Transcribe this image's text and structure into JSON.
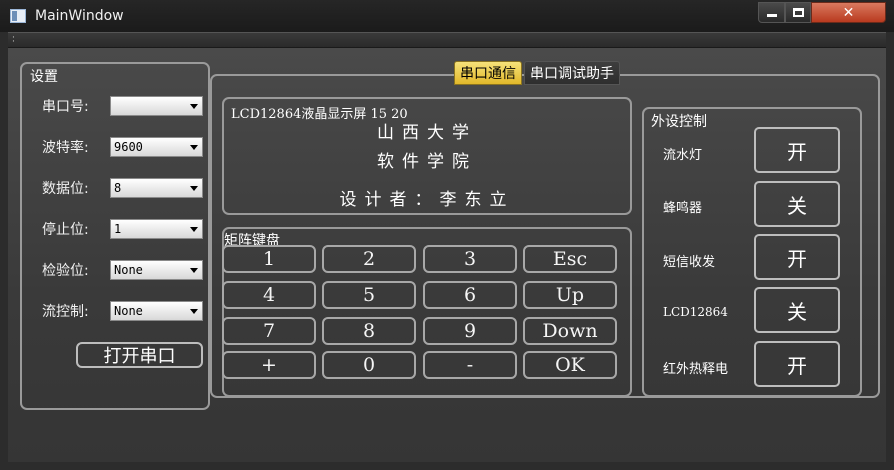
{
  "window": {
    "title": "MainWindow",
    "close_symbol": "✕"
  },
  "settings": {
    "title": "设置",
    "rows": [
      {
        "label": "串口号:",
        "value": ""
      },
      {
        "label": "波特率:",
        "value": "9600"
      },
      {
        "label": "数据位:",
        "value": "8"
      },
      {
        "label": "停止位:",
        "value": "1"
      },
      {
        "label": "检验位:",
        "value": "None"
      },
      {
        "label": "流控制:",
        "value": "None"
      }
    ],
    "open_port_label": "打开串口"
  },
  "tabs": [
    {
      "label": "串口通信",
      "active": true
    },
    {
      "label": "串口调试助手",
      "active": false
    }
  ],
  "lcd": {
    "title": "LCD12864液晶显示屏   15 20",
    "line1": "山西大学",
    "line2": "软件学院",
    "line3": "设计者：李东立"
  },
  "keypad": {
    "title": "矩阵键盘",
    "keys": [
      [
        "1",
        "2",
        "3",
        "Esc"
      ],
      [
        "4",
        "5",
        "6",
        "Up"
      ],
      [
        "7",
        "8",
        "9",
        "Down"
      ],
      [
        "+",
        "0",
        "-",
        "OK"
      ]
    ]
  },
  "peripherals": {
    "title": "外设控制",
    "items": [
      {
        "label": "流水灯",
        "state": "开"
      },
      {
        "label": "蜂鸣器",
        "state": "关"
      },
      {
        "label": "短信收发",
        "state": "开"
      },
      {
        "label": "LCD12864",
        "state": "关"
      },
      {
        "label": "红外热释电",
        "state": "开"
      }
    ]
  }
}
